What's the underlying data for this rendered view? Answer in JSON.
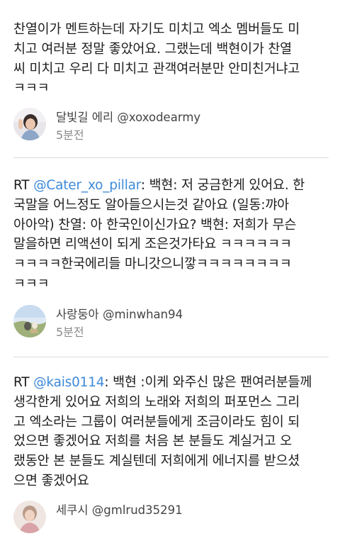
{
  "posts": [
    {
      "lines": [
        "찬열이가 멘트하는데 자기도 미치고 엑소 멤버들도 미",
        "치고 여러분 정말 좋았어요. 그랬는데 백현이가 찬열",
        "씨 미치고 우리 다 미치고 관객여러분만 안미친거냐고",
        "ㅋㅋㅋ"
      ],
      "author": "달빛길 에리 @xoxodearmy",
      "time": "5분전",
      "avatar_icon": "profile-photo-icon"
    },
    {
      "rt_prefix": "RT ",
      "mention": "@Cater_xo_pillar",
      "lines": [
        ": 백현: 저 궁금한게 있어요. 한",
        "국말을 어느정도 알아들으시는것 같아요 (일동:꺄아",
        "아아악) 찬열: 아 한국인이신가요? 백현: 저희가 무슨",
        "말을하면 리액션이 되게 조은것가타요 ㅋㅋㅋㅋㅋㅋ",
        "ㅋㅋㅋㅋ한국에리들 마니갓으니깧ㅋㅋㅋㅋㅋㅋㅋㅋ",
        "ㅋㅋㅋ"
      ],
      "author": "사랑둥아 @minwhan94",
      "time": "5분전",
      "avatar_icon": "profile-photo-icon"
    },
    {
      "rt_prefix": "RT ",
      "mention": "@kais0114",
      "lines": [
        ": 백현 :이케 와주신 많은 팬여러분들께",
        "생각한게 있어요 저희의 노래와 저희의 퍼포먼스 그리",
        "고 엑소라는 그룹이 여러분들에게 조금이라도 힘이 되",
        "었으면 좋겠어요 저희를 처음 본 분들도 계실거고 오",
        "랬동안 본 분들도 계실텐데 저희에게 에너지를 받으셨",
        "으면 좋겠어요"
      ],
      "author": "세쿠시 @gmlrud35291",
      "avatar_icon": "profile-photo-icon"
    }
  ],
  "colors": {
    "mention": "#3d8ad9",
    "divider": "#dcdcdc",
    "meta": "#8a8a8a"
  }
}
